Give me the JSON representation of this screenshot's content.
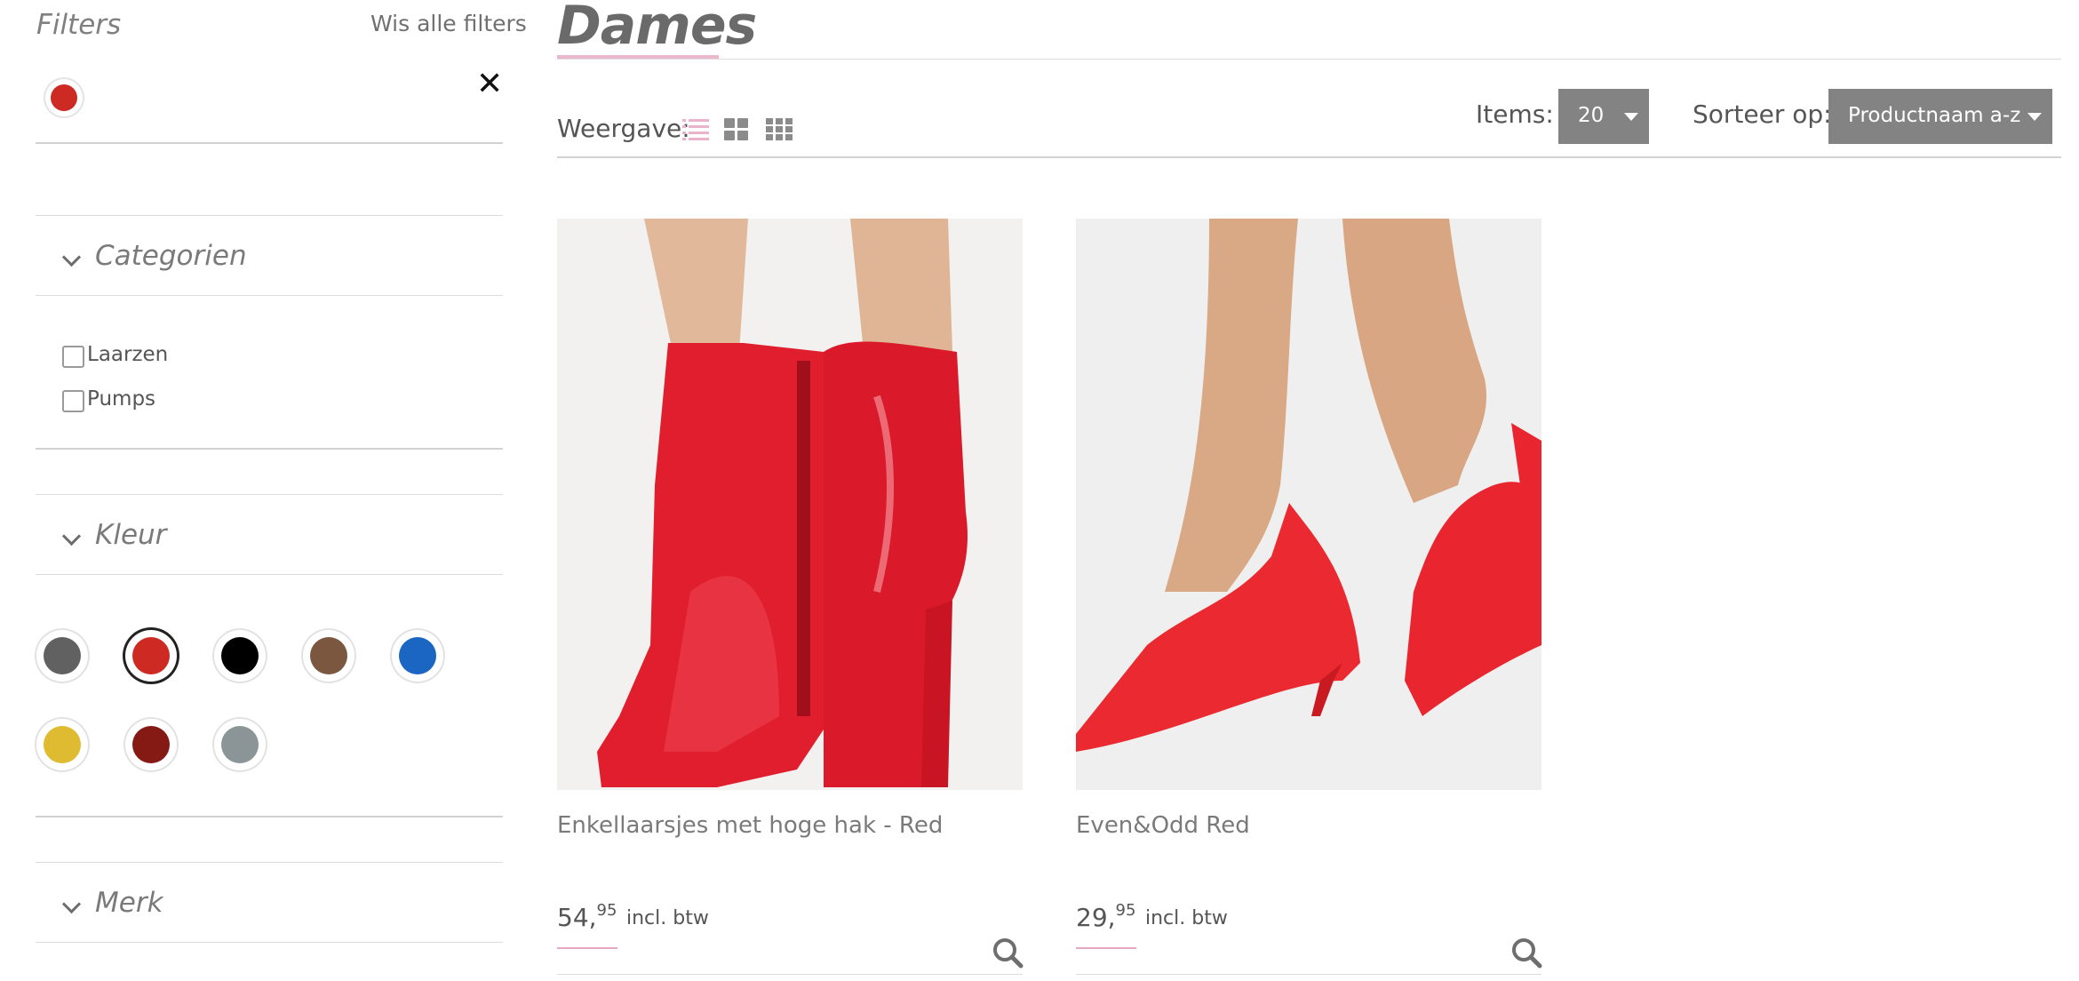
{
  "sidebar": {
    "filters_title": "Filters",
    "clear_all_label": "Wis alle filters",
    "active_filter_color": "#cc2a22",
    "sections": {
      "categories": {
        "title": "Categorien",
        "items": [
          {
            "label": "Laarzen",
            "checked": false
          },
          {
            "label": "Pumps",
            "checked": false
          }
        ]
      },
      "color": {
        "title": "Kleur",
        "swatches": [
          {
            "name": "grey",
            "hex": "#616161",
            "selected": false
          },
          {
            "name": "red",
            "hex": "#cc2a22",
            "selected": true
          },
          {
            "name": "black",
            "hex": "#000000",
            "selected": false
          },
          {
            "name": "brown",
            "hex": "#7b5740",
            "selected": false
          },
          {
            "name": "blue",
            "hex": "#1a66c2",
            "selected": false
          },
          {
            "name": "yellow",
            "hex": "#dfbb31",
            "selected": false
          },
          {
            "name": "dark-red",
            "hex": "#851914",
            "selected": false
          },
          {
            "name": "light-grey",
            "hex": "#8b9597",
            "selected": false
          }
        ]
      },
      "brand": {
        "title": "Merk"
      }
    }
  },
  "main": {
    "title": "Dames",
    "toolbar": {
      "view_label": "Weergave:",
      "items_label": "Items:",
      "items_value": "20",
      "sort_label": "Sorteer op:",
      "sort_value": "Productnaam a-z"
    },
    "products": [
      {
        "name": "Enkellaarsjes met hoge hak - Red",
        "price_whole": "54,",
        "price_cents": "95",
        "price_note": "incl. btw",
        "image": "red-patent-ankle-boots"
      },
      {
        "name": "Even&Odd Red",
        "price_whole": "29,",
        "price_cents": "95",
        "price_note": "incl. btw",
        "image": "red-suede-pumps"
      }
    ]
  },
  "colors": {
    "accent_pink": "#e7a7c0",
    "select_bg": "#838383",
    "list_view_icon": "#eab3c9",
    "grid_icon": "#8b8b8b"
  },
  "icons": {
    "remove_filter": "close-icon",
    "section_toggle": "chevron-down-icon",
    "view_list": "list-view-icon",
    "view_grid": "grid-view-icon",
    "view_grid_small": "grid-small-view-icon",
    "zoom": "search-icon"
  }
}
